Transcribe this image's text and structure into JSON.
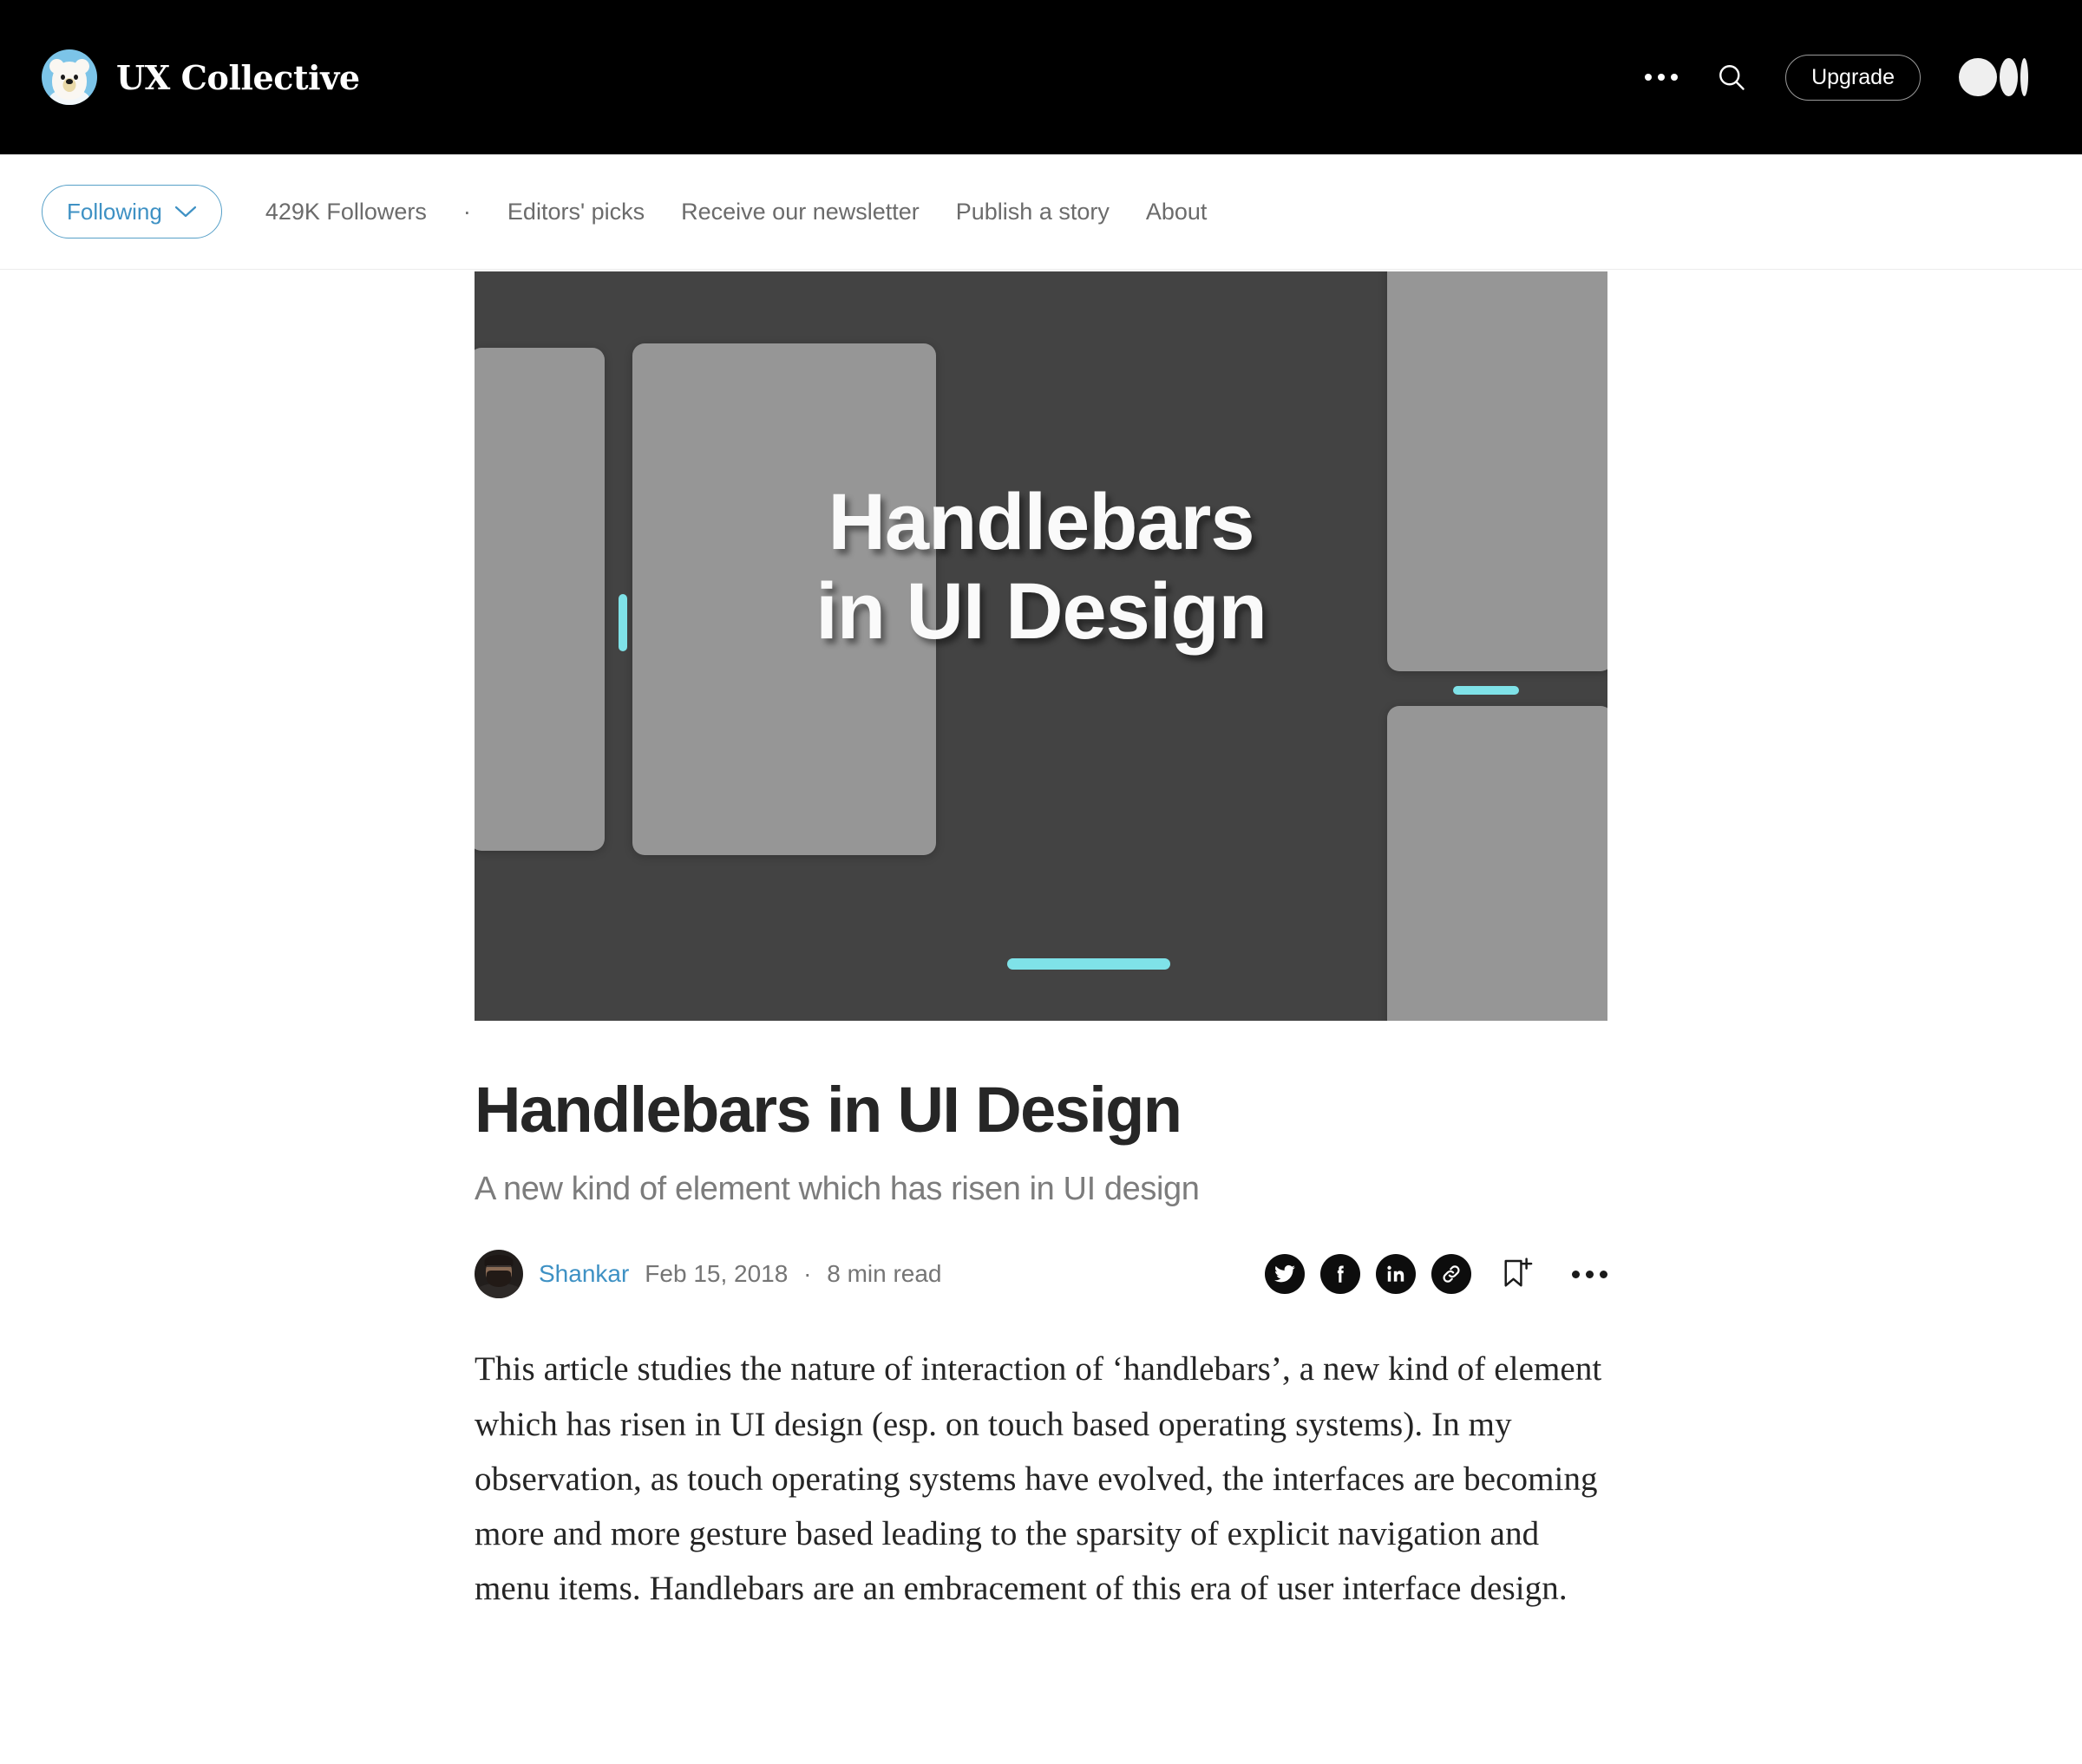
{
  "topbar": {
    "brand_name": "UX Collective",
    "logo_icon": "polar-bear-logo",
    "overflow_icon": "ellipsis-icon",
    "search_icon": "search-icon",
    "upgrade_label": "Upgrade",
    "medium_logo_icon": "medium-logo-icon"
  },
  "pubnav": {
    "follow_label": "Following",
    "follow_chevron_icon": "chevron-down-icon",
    "followers": "429K Followers",
    "separator": "·",
    "links": [
      {
        "label": "Editors' picks"
      },
      {
        "label": "Receive our newsletter"
      },
      {
        "label": "Publish a story"
      },
      {
        "label": "About"
      }
    ]
  },
  "hero": {
    "title_line1": "Handlebars",
    "title_line2": "in UI Design",
    "bg_color": "#434343",
    "panel_color": "#969696",
    "handle_color": "#7FE2E8"
  },
  "article": {
    "title": "Handlebars in UI Design",
    "subtitle": "A new kind of element which has risen in UI design",
    "author": "Shankar",
    "date": "Feb 15, 2018",
    "read_time": "8 min read",
    "meta_separator": "·",
    "avatar_icon": "author-avatar",
    "share": {
      "twitter_icon": "twitter-icon",
      "facebook_icon": "facebook-icon",
      "linkedin_icon": "linkedin-icon",
      "link_icon": "link-icon",
      "bookmark_icon": "bookmark-add-icon",
      "more_icon": "ellipsis-icon"
    },
    "paragraph": "This article studies the nature of interaction of ‘handlebars’, a new kind of element which has risen in UI design (esp. on touch based operating systems). In my observation, as touch operating systems have evolved, the interfaces are becoming more and more gesture based leading to the sparsity of explicit navigation and menu items. Handlebars are an embracement of this era of user interface design."
  },
  "colors": {
    "accent_blue": "#3E91C4",
    "header_black": "#000000",
    "muted_text": "#6B6B6B"
  }
}
